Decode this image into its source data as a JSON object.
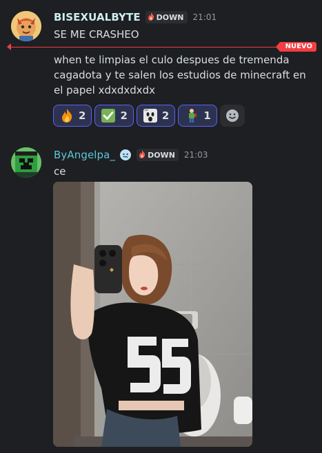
{
  "messages": [
    {
      "username": "BISEXUALBYTE",
      "username_color": "#cdeef0",
      "tag_label": "DOWN",
      "timestamp": "21:01",
      "lines": [
        "SE ME CRASHEO"
      ],
      "avatar_icon": "cartoon-fox-avatar"
    },
    {
      "lines": [
        "when te limpias el culo despues de tremenda",
        "cagadota y te salen los estudios de minecraft en",
        "el papel xdxdxdxdx"
      ],
      "reactions": [
        {
          "icon": "fire-icon",
          "count": "2"
        },
        {
          "icon": "check-icon",
          "count": "2"
        },
        {
          "icon": "ghost-face-icon",
          "count": "2"
        },
        {
          "icon": "figure-icon",
          "count": "1"
        }
      ]
    },
    {
      "username": "ByAngelpa_",
      "username_color": "#5ac8d8",
      "tag_label": "DOWN",
      "timestamp": "21:03",
      "lines": [
        "ce"
      ],
      "avatar_icon": "creeper-avatar",
      "attachment": "mirror-selfie-photo"
    }
  ],
  "divider_label": "NUEVO",
  "colors": {
    "accent": "#5865f2",
    "new_divider": "#f23f43",
    "background": "#1e1f22"
  }
}
